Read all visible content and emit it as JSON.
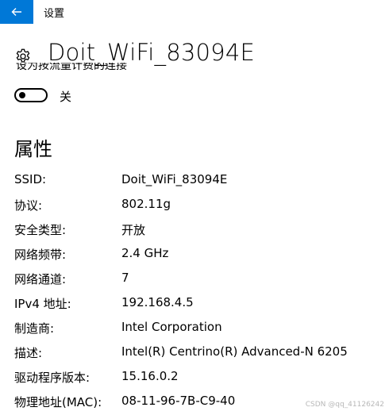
{
  "window": {
    "title": "设置"
  },
  "header": {
    "title": "Doit_WiFi_83094E"
  },
  "metered": {
    "cut_label": "设为按流量计费的连接",
    "toggle_state": "关"
  },
  "properties": {
    "title": "属性",
    "rows": [
      {
        "label": "SSID:",
        "value": "Doit_WiFi_83094E"
      },
      {
        "label": "协议:",
        "value": "802.11g"
      },
      {
        "label": "安全类型:",
        "value": "开放"
      },
      {
        "label": "网络频带:",
        "value": "2.4 GHz"
      },
      {
        "label": "网络通道:",
        "value": "7"
      },
      {
        "label": "IPv4 地址:",
        "value": "192.168.4.5"
      },
      {
        "label": "制造商:",
        "value": "Intel Corporation"
      },
      {
        "label": "描述:",
        "value": "Intel(R) Centrino(R) Advanced-N 6205"
      },
      {
        "label": "驱动程序版本:",
        "value": "15.16.0.2"
      },
      {
        "label": "物理地址(MAC):",
        "value": "08-11-96-7B-C9-40"
      }
    ]
  },
  "watermark": "CSDN @qq_41126242",
  "colors": {
    "accent": "#0078d7",
    "background": "#ffffff",
    "text": "#000000"
  },
  "icons": {
    "back": "arrow-left-icon",
    "header": "gear-icon"
  }
}
